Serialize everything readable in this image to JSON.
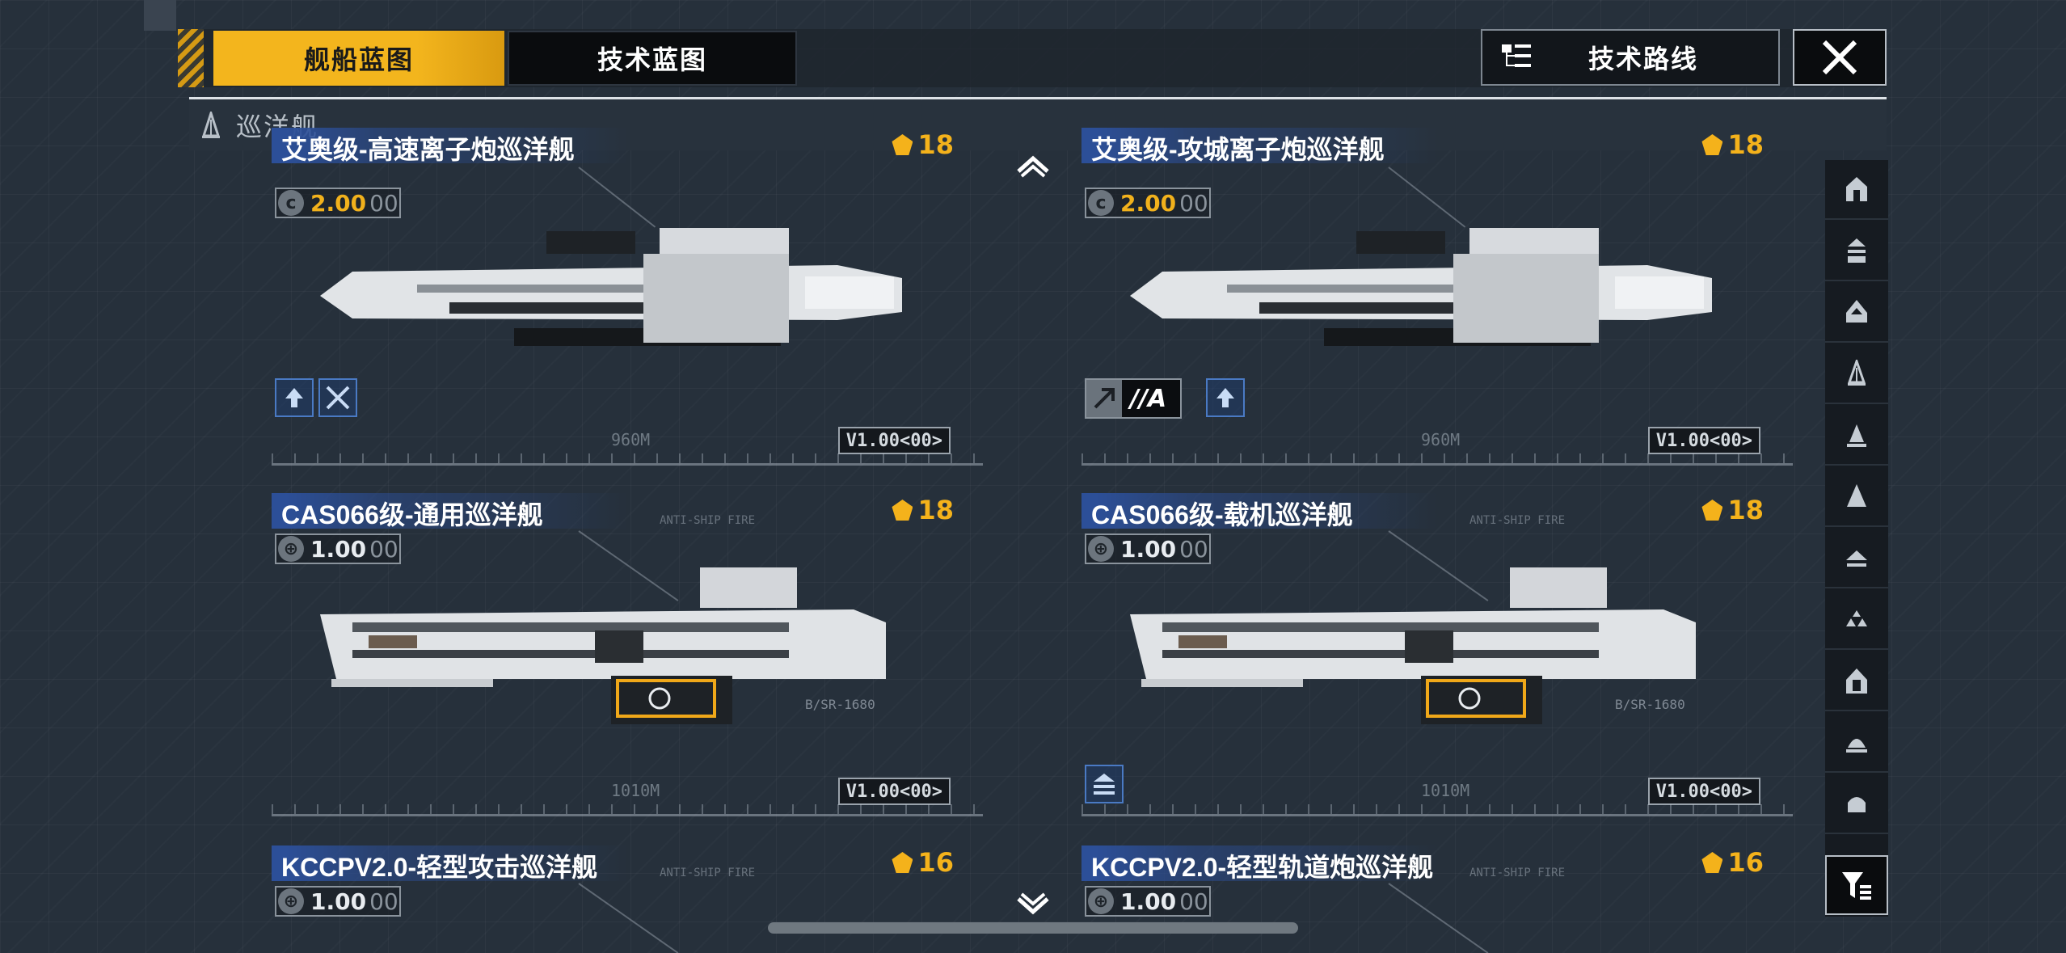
{
  "tabs": {
    "ship": "舰船蓝图",
    "tech": "技术蓝图"
  },
  "tech_route": "技术路线",
  "category": {
    "title": "巡洋舰"
  },
  "cards": [
    {
      "name": "艾奥级-高速离子炮巡洋舰",
      "rank": "18",
      "cost_value": "2.00",
      "cost_decimals": "00",
      "version": "V1.00<00>",
      "length": "960M",
      "anti_label": "",
      "bsr_label": "",
      "features": [
        "up-arrow-icon",
        "crossed-swords-icon"
      ]
    },
    {
      "name": "艾奥级-攻城离子炮巡洋舰",
      "rank": "18",
      "cost_value": "2.00",
      "cost_decimals": "00",
      "version": "V1.00<00>",
      "length": "960M",
      "anti_label": "",
      "bsr_label": "",
      "badge_text": "//A",
      "features": [
        "up-arrow-icon"
      ]
    },
    {
      "name": "CAS066级-通用巡洋舰",
      "rank": "18",
      "cost_value": "1.00",
      "cost_decimals": "00",
      "version": "V1.00<00>",
      "length": "1010M",
      "anti_label": "ANTI-SHIP FIRE",
      "bsr_label": "B/SR-1680",
      "features": []
    },
    {
      "name": "CAS066级-载机巡洋舰",
      "rank": "18",
      "cost_value": "1.00",
      "cost_decimals": "00",
      "version": "V1.00<00>",
      "length": "1010M",
      "anti_label": "ANTI-SHIP FIRE",
      "bsr_label": "B/SR-1680",
      "features": [
        "carrier-icon"
      ]
    },
    {
      "name": "KCCPV2.0-轻型攻击巡洋舰",
      "rank": "16",
      "cost_value": "1.00",
      "cost_decimals": "00",
      "anti_label": "ANTI-SHIP FIRE"
    },
    {
      "name": "KCCPV2.0-轻型轨道炮巡洋舰",
      "rank": "16",
      "cost_value": "1.00",
      "cost_decimals": "00",
      "anti_label": "ANTI-SHIP FIRE"
    }
  ],
  "side_filters": [
    "class-1-icon",
    "class-2-icon",
    "class-3-icon",
    "cruiser-icon",
    "class-5-icon",
    "class-6-icon",
    "class-7-icon",
    "class-8-icon",
    "class-9-icon",
    "class-10-icon",
    "class-11-icon"
  ],
  "colors": {
    "accent": "#f3b51d",
    "rank": "#f4b21b",
    "blue": "#2c4f98",
    "bg": "#26303b"
  }
}
